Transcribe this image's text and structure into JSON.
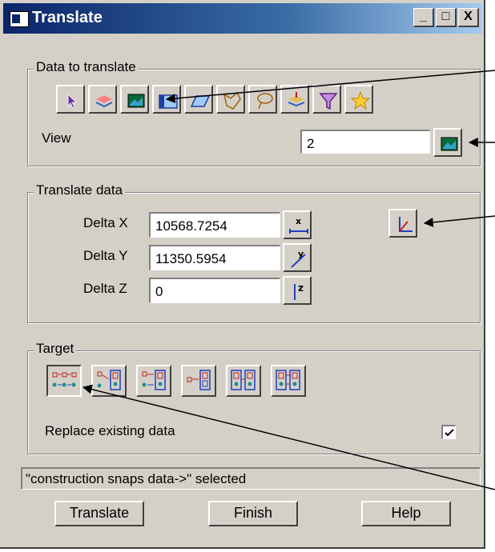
{
  "window": {
    "title": "Translate"
  },
  "titlebar_buttons": {
    "minimize": "_",
    "maximize": "□",
    "close": "X"
  },
  "data_to_translate": {
    "legend": "Data to translate",
    "icons": [
      "pointer-icon",
      "layers-icon",
      "view-icon",
      "model-icon",
      "parallelogram-icon",
      "polygon-icon",
      "lasso-icon",
      "stack-icon",
      "filter-icon",
      "star-icon"
    ],
    "view_label": "View",
    "view_value": "2"
  },
  "translate_data": {
    "legend": "Translate data",
    "delta_x_label": "Delta X",
    "delta_x_value": "10568.7254",
    "delta_y_label": "Delta Y",
    "delta_y_value": "11350.5954",
    "delta_z_label": "Delta Z",
    "delta_z_value": "0"
  },
  "target": {
    "legend": "Target",
    "replace_label": "Replace existing data",
    "replace_checked": true
  },
  "status_text": "\"construction snaps data->\" selected",
  "buttons": {
    "translate": "Translate",
    "finish": "Finish",
    "help": "Help"
  }
}
